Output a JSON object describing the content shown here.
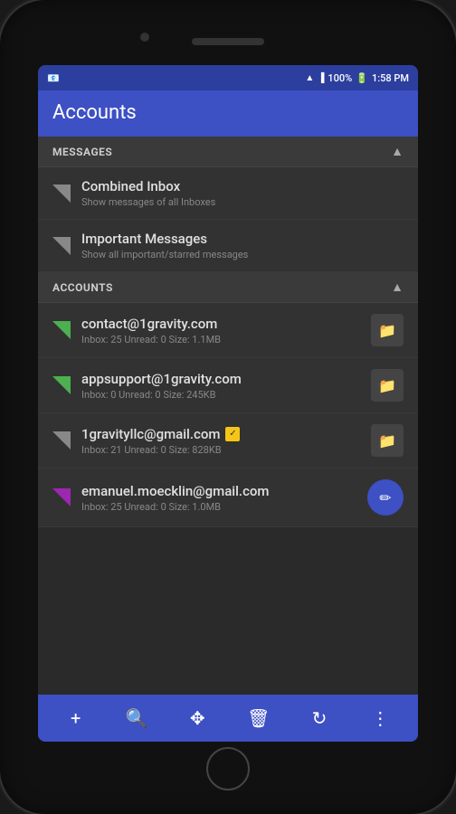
{
  "status": {
    "wifi": "wifi",
    "signal": "signal",
    "battery_percent": "100%",
    "battery_icon": "🔋",
    "time": "1:58 PM"
  },
  "header": {
    "title": "Accounts"
  },
  "sections": {
    "messages": {
      "label": "MESSAGES",
      "items": [
        {
          "primary": "Combined Inbox",
          "secondary": "Show messages of all Inboxes",
          "icon_type": "gray",
          "action": "folder"
        },
        {
          "primary": "Important Messages",
          "secondary": "Show all important/starred messages",
          "icon_type": "gray",
          "action": "folder"
        }
      ]
    },
    "accounts": {
      "label": "ACCOUNTS",
      "items": [
        {
          "primary": "contact@1gravity.com",
          "secondary": "Inbox: 25   Unread: 0   Size: 1.1MB",
          "icon_type": "green",
          "action": "folder",
          "badge": null,
          "is_fab": false
        },
        {
          "primary": "appsupport@1gravity.com",
          "secondary": "Inbox: 0   Unread: 0   Size: 245KB",
          "icon_type": "green",
          "action": "folder",
          "badge": null,
          "is_fab": false
        },
        {
          "primary": "1gravityllc@gmail.com",
          "secondary": "Inbox: 21   Unread: 0   Size: 828KB",
          "icon_type": "yellow",
          "action": "folder",
          "badge": "✓",
          "is_fab": false
        },
        {
          "primary": "emanuel.moecklin@gmail.com",
          "secondary": "Inbox: 25   Unread: 0   Size: 1.0MB",
          "icon_type": "purple",
          "action": "edit",
          "badge": null,
          "is_fab": true
        }
      ]
    }
  },
  "toolbar": {
    "buttons": [
      {
        "name": "add",
        "icon": "+"
      },
      {
        "name": "search",
        "icon": "🔍"
      },
      {
        "name": "move",
        "icon": "✥"
      },
      {
        "name": "delete",
        "icon": "🗑"
      },
      {
        "name": "refresh",
        "icon": "↻"
      },
      {
        "name": "more",
        "icon": "⋮"
      }
    ]
  }
}
